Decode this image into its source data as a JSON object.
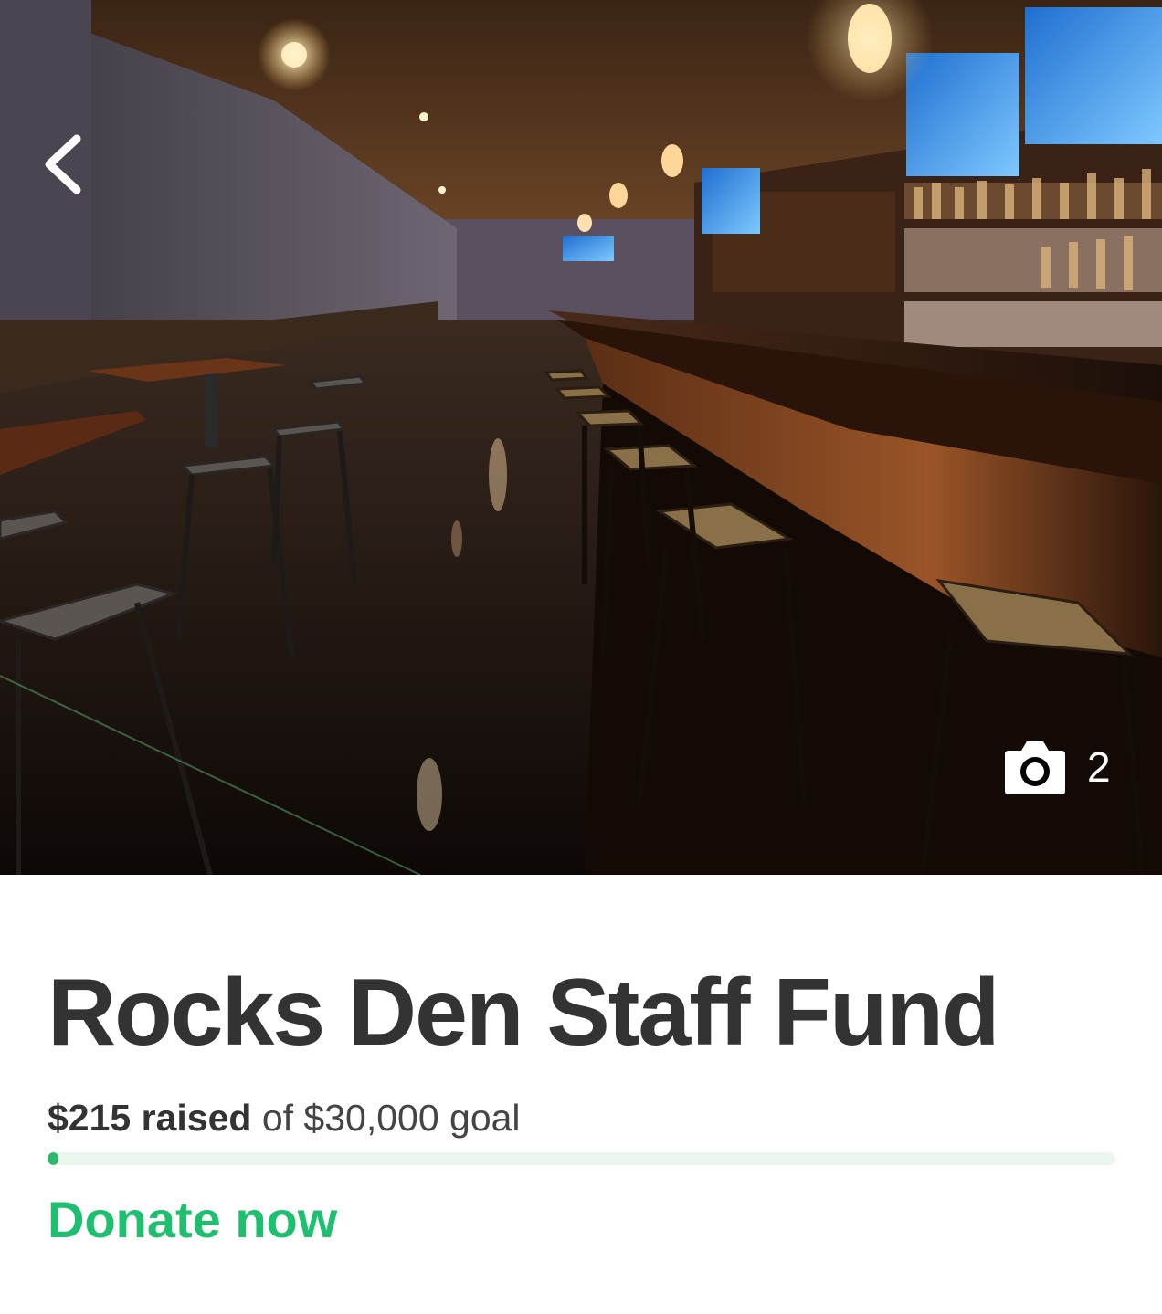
{
  "hero": {
    "photo_count": "2",
    "back_icon": "chevron-left-icon",
    "camera_icon": "camera-icon"
  },
  "fundraiser": {
    "title": "Rocks Den Staff Fund",
    "raised_amount": "$215",
    "raised_label": "raised",
    "goal_text": "of $30,000 goal",
    "progress_fraction": 0.00717
  },
  "actions": {
    "donate_label": "Donate now"
  },
  "colors": {
    "brand_green": "#1ebf6f",
    "progress_fill": "#2bb96b",
    "progress_track": "#e9f7ee",
    "title_text": "#333333"
  }
}
